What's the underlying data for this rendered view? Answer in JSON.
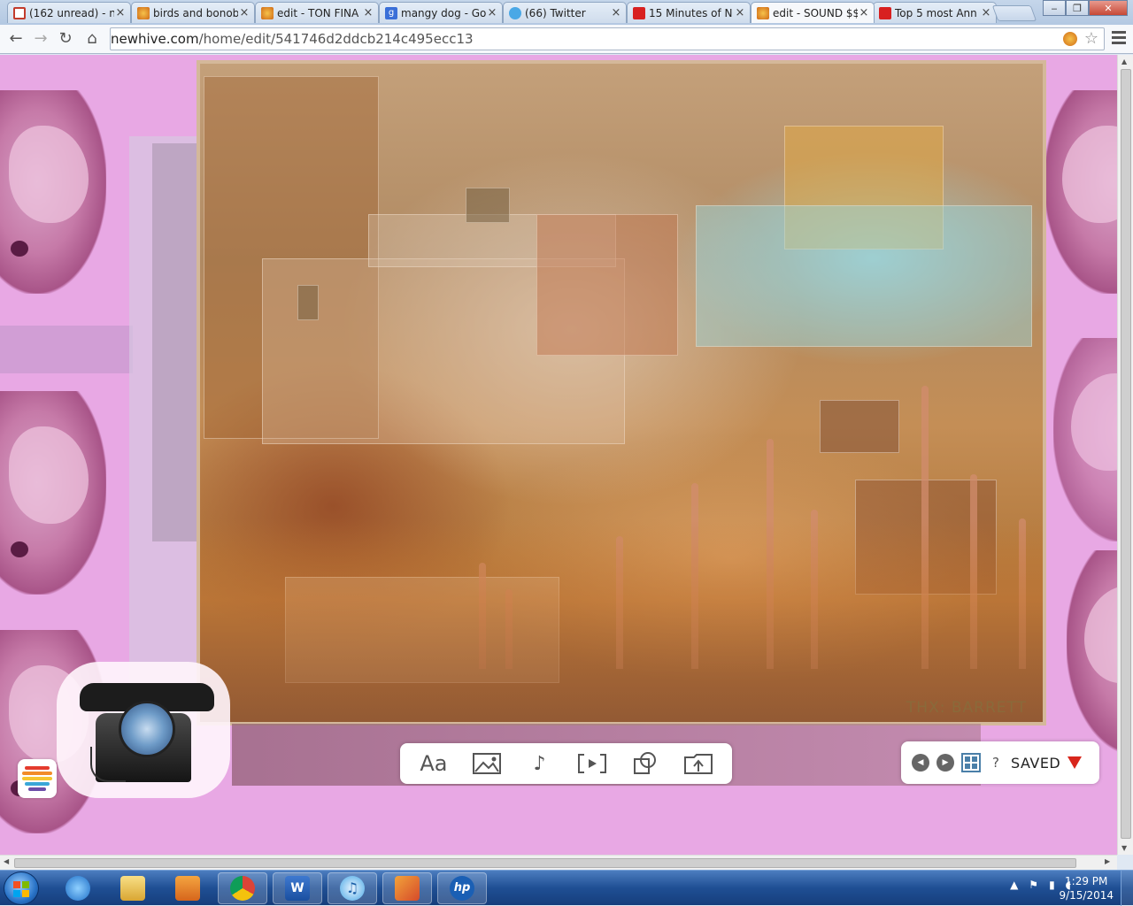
{
  "browser": {
    "tabs": [
      {
        "label": "(162 unread) - n",
        "favicon": "gmail-icon",
        "color": "#c23b2c",
        "active": false
      },
      {
        "label": "birds and bonob",
        "favicon": "newhive-icon",
        "color": "#e0883a",
        "active": false
      },
      {
        "label": "edit - TON FINA",
        "favicon": "newhive-icon",
        "color": "#e0883a",
        "active": false
      },
      {
        "label": "mangy dog - Go",
        "favicon": "google-icon",
        "color": "#3a6fd8",
        "active": false
      },
      {
        "label": "(66) Twitter",
        "favicon": "twitter-icon",
        "color": "#4aa8e6",
        "active": false
      },
      {
        "label": "15 Minutes of N",
        "favicon": "youtube-icon",
        "color": "#d82020",
        "active": false
      },
      {
        "label": "edit - SOUND $$",
        "favicon": "newhive-icon",
        "color": "#e0883a",
        "active": true
      },
      {
        "label": "Top 5 most Ann",
        "favicon": "youtube-icon",
        "color": "#d82020",
        "active": false
      }
    ],
    "url_host": "newhive.com",
    "url_path": "/home/edit/541746d2ddcb214c495ecc13",
    "window_controls": {
      "minimize": "‒",
      "restore": "❐",
      "close": "✕"
    }
  },
  "canvas": {
    "credit_text": "THX: BARRETT"
  },
  "editor_toolbar": {
    "text_label": "Aa",
    "buttons": [
      "text-tool-icon",
      "image-tool-icon",
      "music-note-icon",
      "embed-tool-icon",
      "shape-tool-icon",
      "upload-folder-icon"
    ]
  },
  "save_panel": {
    "help_label": "?",
    "saved_label": "SAVED",
    "accent": "#d8261c"
  },
  "taskbar": {
    "apps": [
      "internet-explorer-icon",
      "file-explorer-icon",
      "media-player-icon",
      "chrome-icon",
      "word-icon",
      "itunes-icon",
      "photo-app-icon",
      "hp-icon"
    ],
    "time": "1:29 PM",
    "date": "9/15/2014"
  }
}
